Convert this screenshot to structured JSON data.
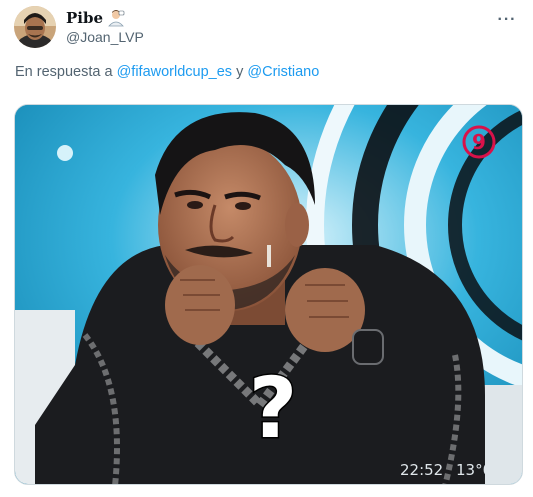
{
  "tweet": {
    "author": {
      "display_name": "Pibe",
      "name_emoji": "person-emoji",
      "handle": "@Joan_LVP",
      "avatar": "avatar-photo"
    },
    "more_icon": "more-horizontal-icon",
    "reply_context": {
      "prefix": "En respuesta a",
      "mention_1": "@fifaworldcup_es",
      "joiner": "y",
      "mention_2": "@Cristiano"
    },
    "media": {
      "channel_logo_text": "9",
      "overlay_glyph": "?",
      "timestamp": "22:52",
      "temperature": "13°0"
    }
  },
  "colors": {
    "link": "#1d9bf0",
    "secondary_text": "#536471",
    "primary_text": "#0f1419",
    "border": "#cfd9de",
    "channel_logo": "#d8124a"
  }
}
